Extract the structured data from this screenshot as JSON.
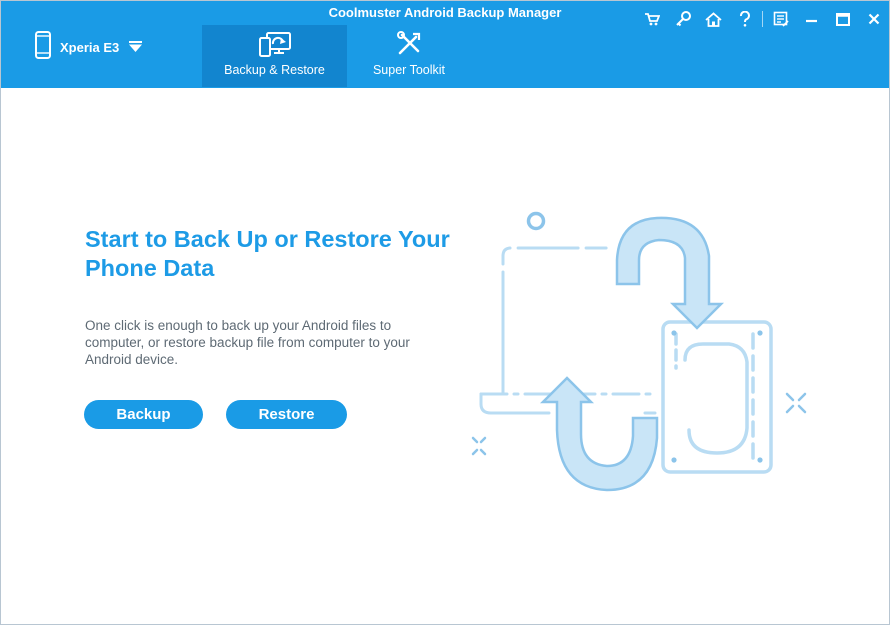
{
  "window": {
    "title": "Coolmuster Android Backup Manager"
  },
  "device": {
    "name": "Xperia E3"
  },
  "tabs": [
    {
      "label": "Backup & Restore",
      "icon": "backup-restore-icon",
      "active": true
    },
    {
      "label": "Super Toolkit",
      "icon": "toolkit-icon",
      "active": false
    }
  ],
  "title_controls": [
    "cart-icon",
    "key-icon",
    "home-icon",
    "help-icon",
    "feedback-icon",
    "minimize-icon",
    "maximize-icon",
    "close-icon"
  ],
  "main": {
    "headline": "Start to Back Up or Restore Your Phone Data",
    "description": "One click is enough to back up your Android files to computer, or restore backup file from computer to your Android device.",
    "backup_label": "Backup",
    "restore_label": "Restore"
  },
  "colors": {
    "accent": "#1a9be6",
    "active_tab": "#1285cf",
    "headline": "#1d9be6",
    "body_text": "#5e6a74",
    "illustration_light": "#b9dcf3",
    "illustration_mid": "#8cc4ea"
  }
}
